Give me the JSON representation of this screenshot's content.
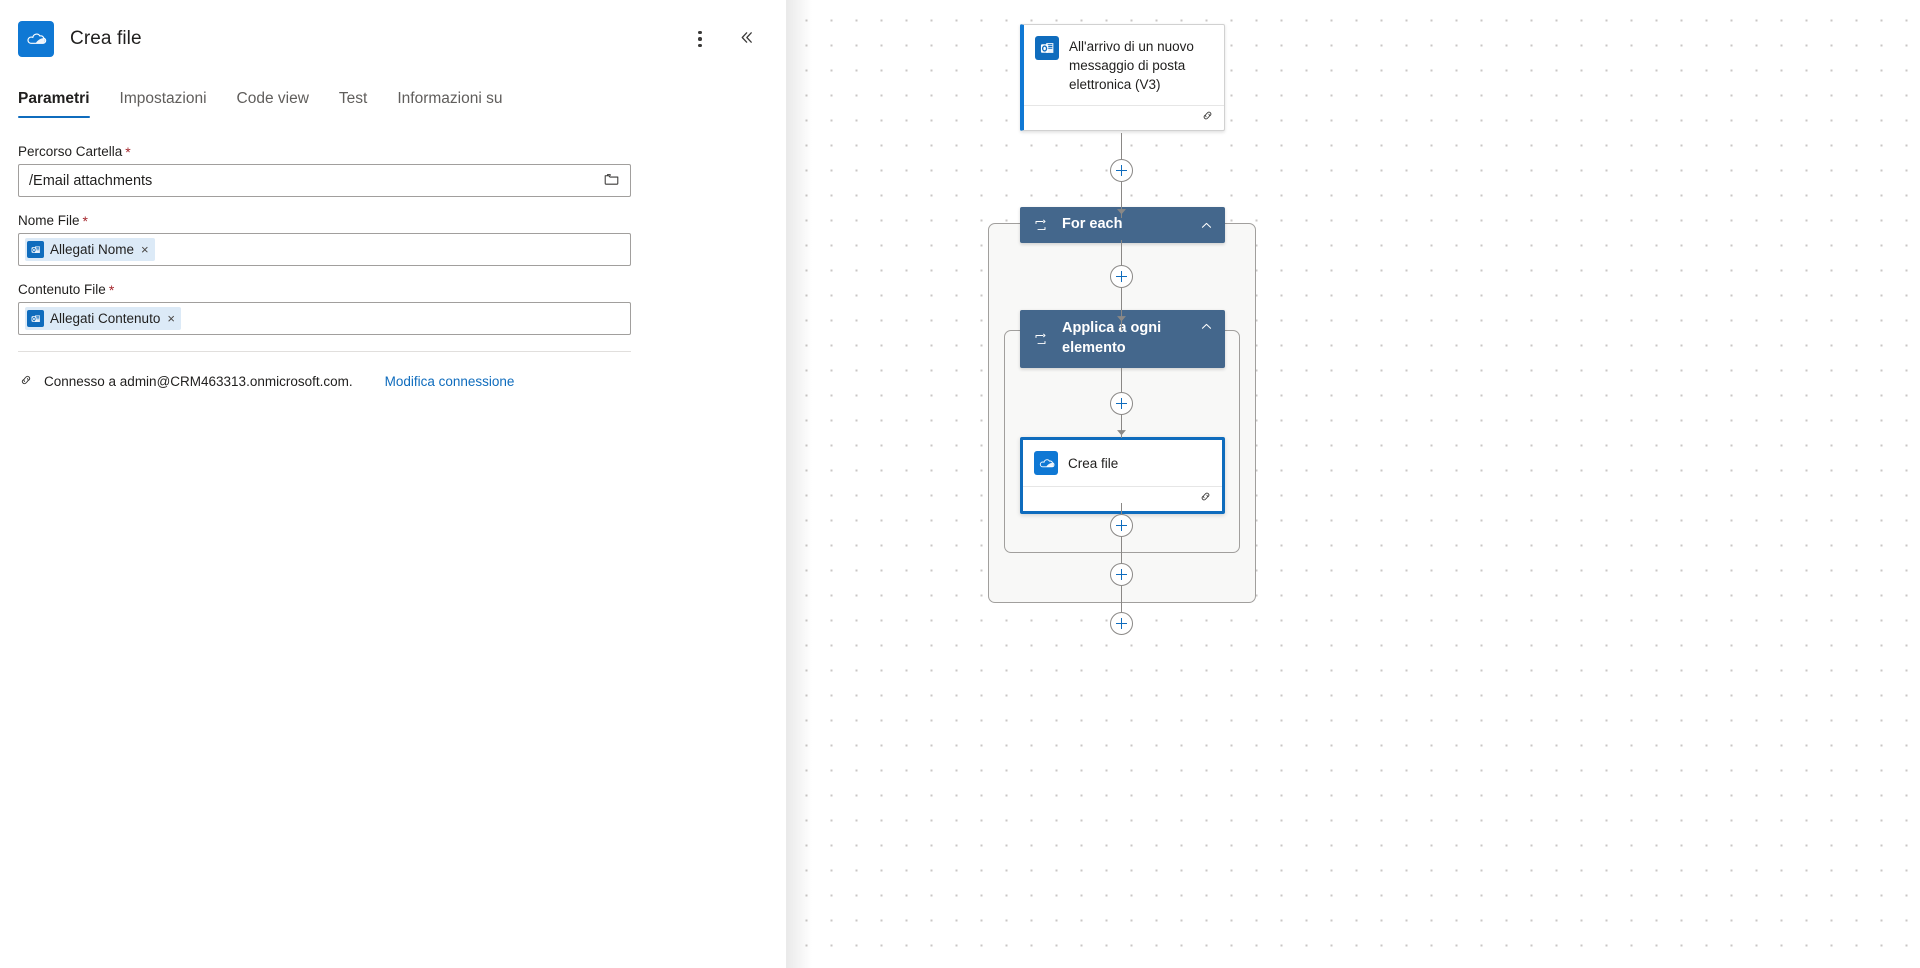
{
  "panel": {
    "icon": "onedrive-icon",
    "title": "Crea file",
    "more_options_label": "Altre opzioni",
    "collapse_label": "Comprimi riquadro",
    "tabs": [
      {
        "label": "Parametri",
        "active": true
      },
      {
        "label": "Impostazioni",
        "active": false
      },
      {
        "label": "Code view",
        "active": false
      },
      {
        "label": "Test",
        "active": false
      },
      {
        "label": "Informazioni su",
        "active": false
      }
    ],
    "fields": [
      {
        "label": "Percorso Cartella",
        "required": "*",
        "type": "text",
        "value": "/Email attachments",
        "placeholder": "",
        "trailing_icon": "folder-icon"
      },
      {
        "label": "Nome File",
        "required": "*",
        "type": "token",
        "token_icon": "outlook-icon",
        "token_text": "Allegati Nome",
        "token_remove": "×"
      },
      {
        "label": "Contenuto File",
        "required": "*",
        "type": "token",
        "token_icon": "outlook-icon",
        "token_text": "Allegati Contenuto",
        "token_remove": "×"
      }
    ],
    "connection": {
      "icon": "link-icon",
      "status": "Connesso a admin@CRM463313.onmicrosoft.com.",
      "action_link": "Modifica connessione"
    }
  },
  "canvas": {
    "trigger": {
      "title": "All'arrivo di un nuovo messaggio di posta elettronica (V3)",
      "icon": "outlook-icon",
      "footer_icon": "link-icon"
    },
    "scopes": [
      {
        "title": "For each",
        "icon": "foreach-icon",
        "chevron": "chevron-up-icon"
      },
      {
        "title": "Applica a ogni elemento",
        "icon": "foreach-icon",
        "chevron": "chevron-up-icon"
      }
    ],
    "action": {
      "title": "Crea file",
      "icon": "onedrive-icon",
      "footer_icon": "link-icon",
      "selected": true
    },
    "add_buttons": [
      {
        "name": "add-step-after-trigger"
      },
      {
        "name": "add-step-in-foreach-top"
      },
      {
        "name": "add-step-in-apply-top"
      },
      {
        "name": "add-step-in-apply-bottom"
      },
      {
        "name": "add-step-in-foreach-bottom"
      },
      {
        "name": "add-step-after-foreach"
      }
    ]
  },
  "colors": {
    "accent": "#0f6cbd",
    "brand_blue": "#0f78d4",
    "scope_header": "#44678c",
    "scope_fill": "#f8f8f7",
    "required": "#a4262c",
    "token_fill": "#dceaf7",
    "border": "#a19f9d"
  }
}
